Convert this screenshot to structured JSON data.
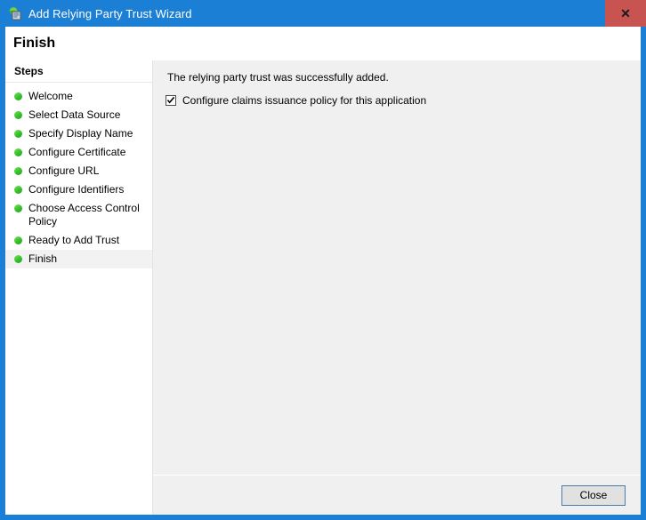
{
  "window": {
    "title": "Add Relying Party Trust Wizard",
    "icon": "wizard-shield-icon",
    "close_label": "✕",
    "accent_color": "#1c7fd6",
    "close_button_color": "#c75450"
  },
  "header": {
    "title": "Finish"
  },
  "sidebar": {
    "header": "Steps",
    "items": [
      {
        "label": "Welcome",
        "selected": false
      },
      {
        "label": "Select Data Source",
        "selected": false
      },
      {
        "label": "Specify Display Name",
        "selected": false
      },
      {
        "label": "Configure Certificate",
        "selected": false
      },
      {
        "label": "Configure URL",
        "selected": false
      },
      {
        "label": "Configure Identifiers",
        "selected": false
      },
      {
        "label": "Choose Access Control Policy",
        "selected": false
      },
      {
        "label": "Ready to Add Trust",
        "selected": false
      },
      {
        "label": "Finish",
        "selected": true
      }
    ],
    "bullet_color": "#33c02b"
  },
  "content": {
    "message": "The relying party trust was successfully added.",
    "checkbox": {
      "label": "Configure claims issuance policy for this application",
      "checked": true
    }
  },
  "footer": {
    "close_label": "Close"
  }
}
